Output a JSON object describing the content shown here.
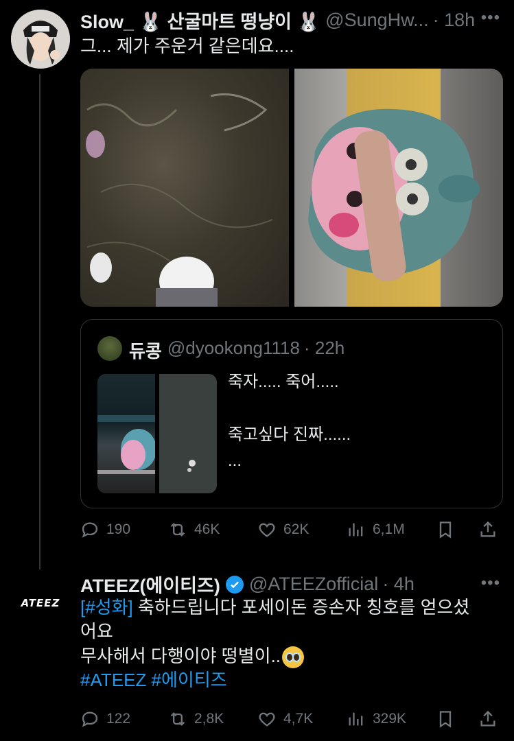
{
  "tweet1": {
    "display_name": "Slow_ 🐰 산굴마트 떵냥이 🐰",
    "handle": "@SungHw...",
    "time": "· 18h",
    "text": "그... 제가 주운거 같은데요....",
    "quote": {
      "display_name": "듀콩",
      "handle": "@dyookong1118",
      "time": "· 22h",
      "text": "죽자..... 죽어.....\n\n죽고싶다 진짜......\n..."
    },
    "actions": {
      "replies": "190",
      "reposts": "46K",
      "likes": "62K",
      "views": "6,1M"
    }
  },
  "tweet2": {
    "avatar_label": "ATEEZ",
    "display_name": "ATEEZ(에이티즈)",
    "handle": "@ATEEZofficial",
    "time": "· 4h",
    "text_link1": "[#성화]",
    "text_line1": " 축하드립니다 포세이돈 증손자 칭호를 얻으셨",
    "text_line2": "어요",
    "text_line3": "무사해서 다행이야 떵별이..",
    "hashtags": "#ATEEZ #에이티즈",
    "actions": {
      "replies": "122",
      "reposts": "2,8K",
      "likes": "4,7K",
      "views": "329K"
    }
  },
  "more_label": "•••",
  "colors": {
    "accent": "#1d9bf0",
    "muted": "#71767b",
    "text": "#e7e9ea",
    "background": "#000000"
  }
}
